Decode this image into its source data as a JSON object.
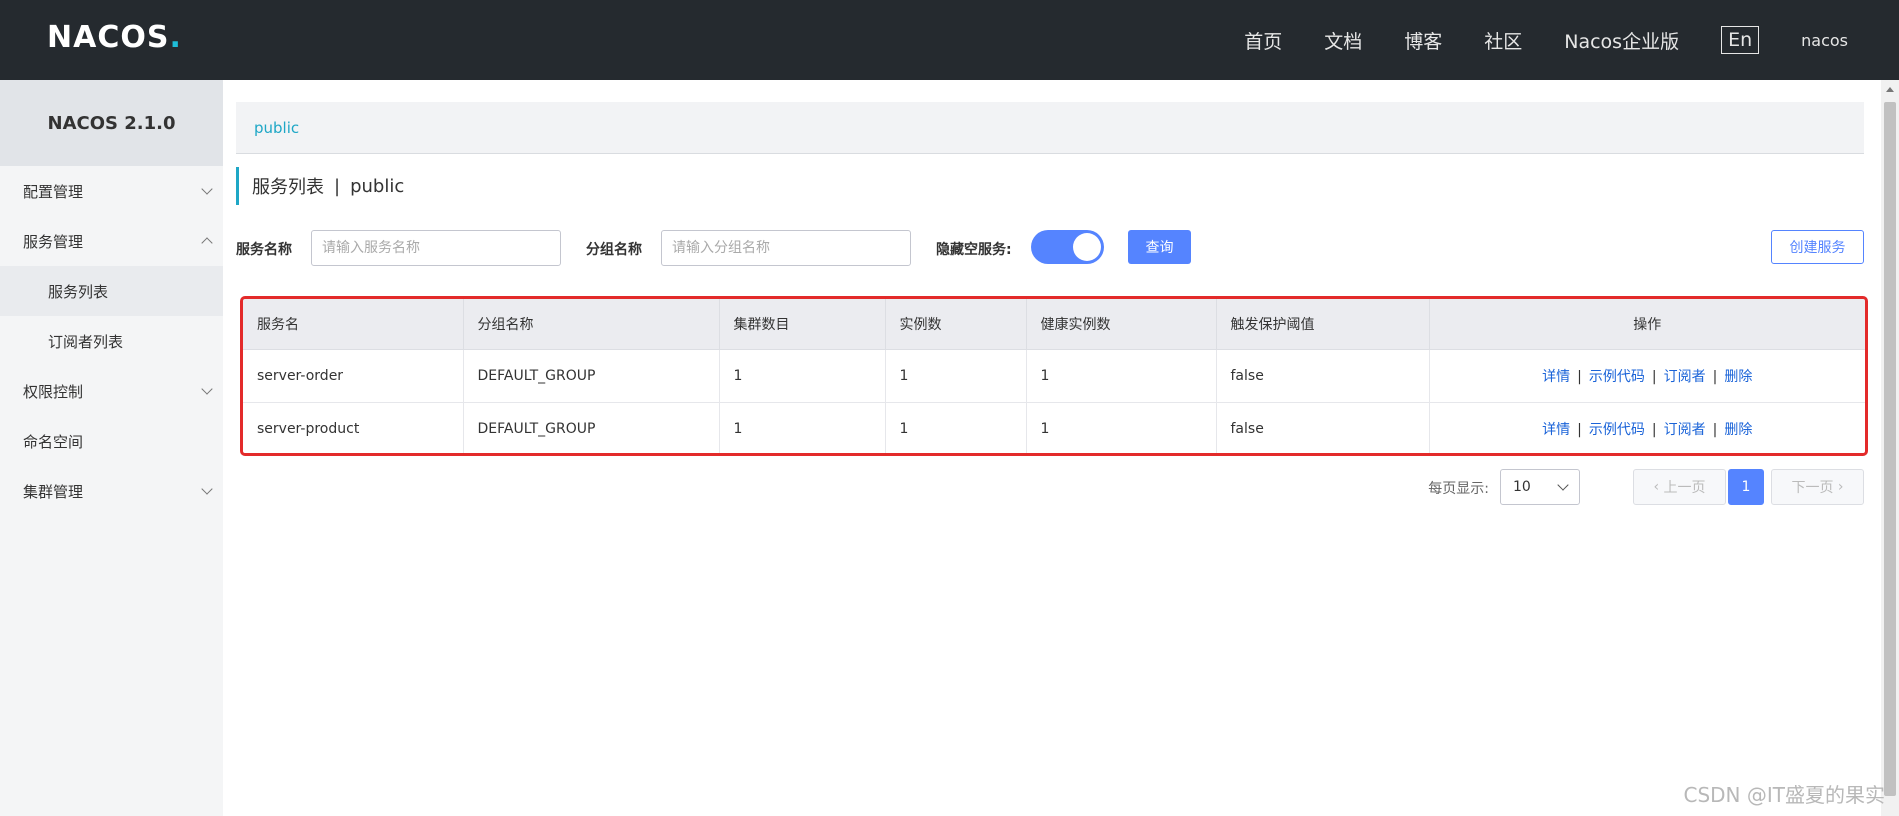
{
  "header": {
    "logo": "NACOS.",
    "nav": [
      "首页",
      "文档",
      "博客",
      "社区",
      "Nacos企业版"
    ],
    "lang": "En",
    "user": "nacos"
  },
  "sidebar": {
    "title": "NACOS 2.1.0",
    "items": [
      {
        "label": "配置管理"
      },
      {
        "label": "服务管理"
      },
      {
        "label": "服务列表"
      },
      {
        "label": "订阅者列表"
      },
      {
        "label": "权限控制"
      },
      {
        "label": "命名空间"
      },
      {
        "label": "集群管理"
      }
    ]
  },
  "breadcrumb": "public",
  "page": {
    "title": "服务列表",
    "sep": "|",
    "namespace": "public"
  },
  "filter": {
    "service_label": "服务名称",
    "service_placeholder": "请输入服务名称",
    "group_label": "分组名称",
    "group_placeholder": "请输入分组名称",
    "hide_empty_label": "隐藏空服务:",
    "query_button": "查询",
    "create_button": "创建服务"
  },
  "table": {
    "headers": [
      "服务名",
      "分组名称",
      "集群数目",
      "实例数",
      "健康实例数",
      "触发保护阈值",
      "操作"
    ],
    "rows": [
      {
        "name": "server-order",
        "group": "DEFAULT_GROUP",
        "clusters": "1",
        "instances": "1",
        "healthy": "1",
        "threshold": "false"
      },
      {
        "name": "server-product",
        "group": "DEFAULT_GROUP",
        "clusters": "1",
        "instances": "1",
        "healthy": "1",
        "threshold": "false"
      }
    ],
    "ops": {
      "detail": "详情",
      "sample": "示例代码",
      "subscriber": "订阅者",
      "delete": "删除",
      "sep": "|"
    }
  },
  "pagination": {
    "per_page_label": "每页显示:",
    "per_page_value": "10",
    "prev": "上一页",
    "current_page": "1",
    "next": "下一页"
  },
  "watermark": "CSDN @IT盛夏的果实",
  "colors": {
    "topbar": "#252a2f",
    "accent": "#5584ff",
    "brand_cyan": "#1ea7c6",
    "highlight": "#e32a2a"
  }
}
